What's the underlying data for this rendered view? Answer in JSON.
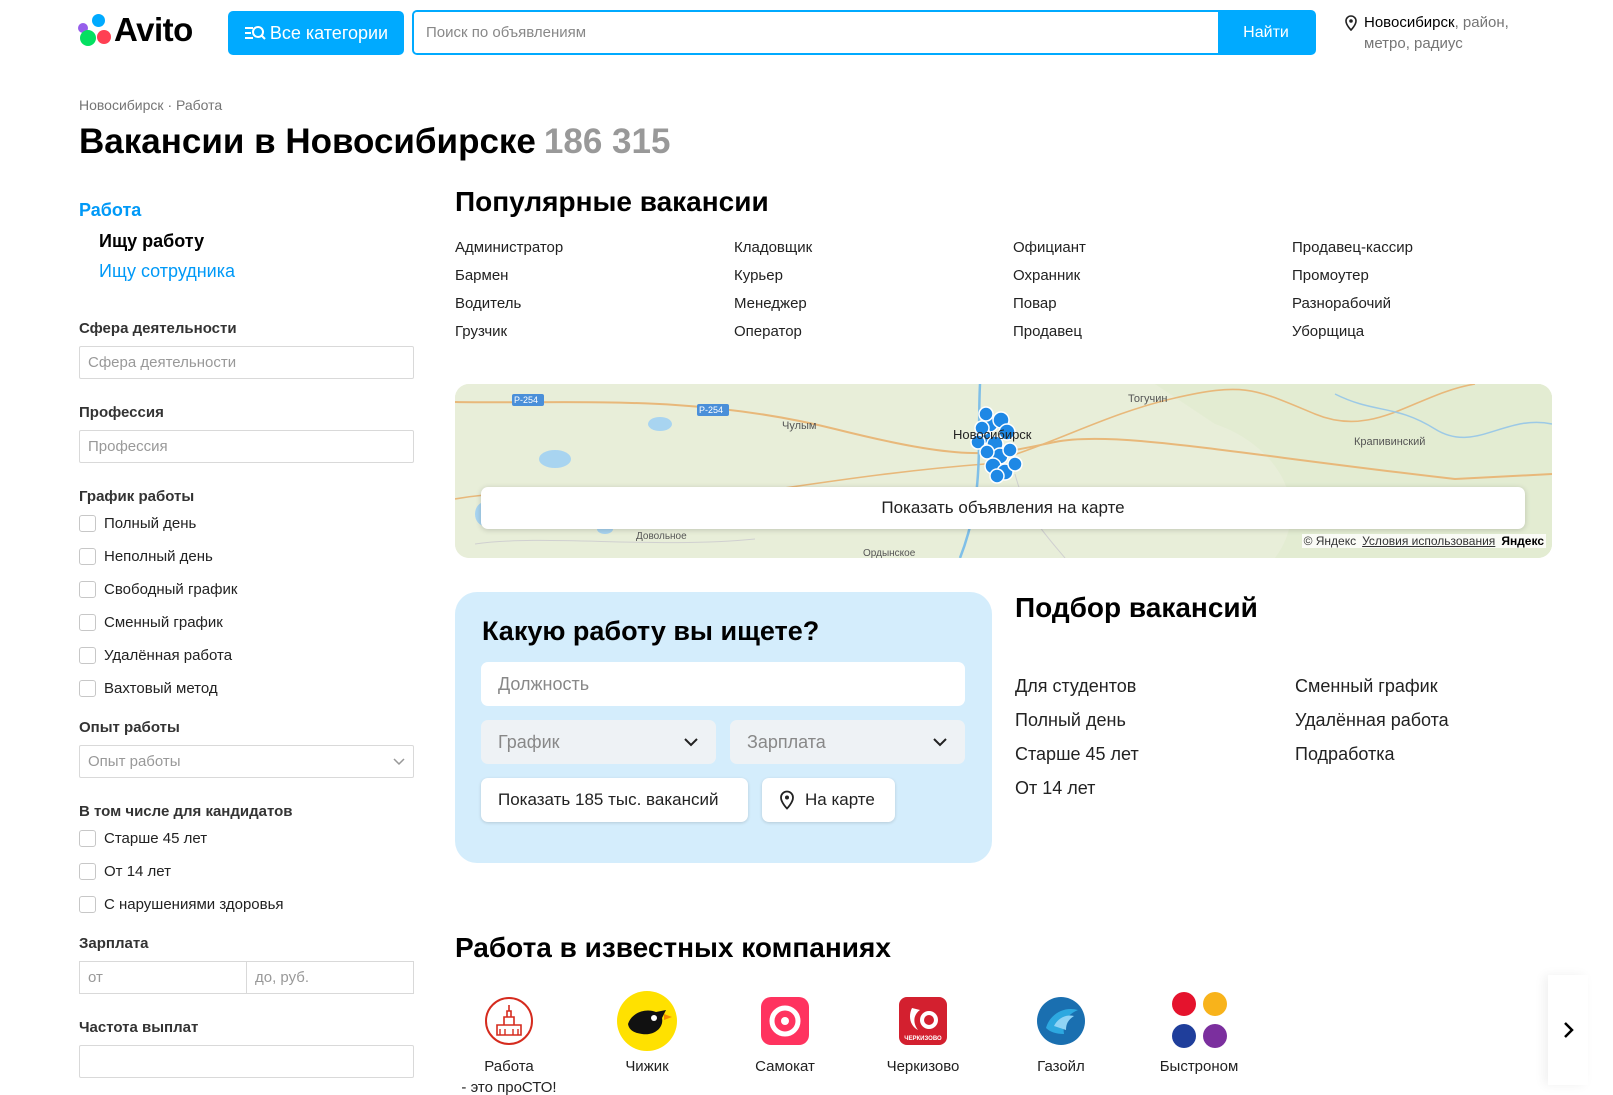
{
  "header": {
    "logo_text": "Avito",
    "categories_label": "Все категории",
    "search_placeholder": "Поиск по объявлениям",
    "search_button": "Найти",
    "location_city": "Новосибирск",
    "location_rest": ", район,",
    "location_line2": "метро, радиус"
  },
  "breadcrumb": {
    "city": "Новосибирск",
    "separator": "·",
    "section": "Работа"
  },
  "title": {
    "text": "Вакансии в Новосибирске",
    "count": "186 315"
  },
  "sidebar": {
    "category": "Работа",
    "sub_active": "Ищу работу",
    "sub_link": "Ищу сотрудника",
    "sphere_label": "Сфера деятельности",
    "sphere_placeholder": "Сфера деятельности",
    "profession_label": "Профессия",
    "profession_placeholder": "Профессия",
    "schedule_label": "График работы",
    "schedule_options": [
      "Полный день",
      "Неполный день",
      "Свободный график",
      "Сменный график",
      "Удалённая работа",
      "Вахтовый метод"
    ],
    "experience_label": "Опыт работы",
    "experience_placeholder": "Опыт работы",
    "candidates_label": "В том числе для кандидатов",
    "candidates_options": [
      "Старше 45 лет",
      "От 14 лет",
      "С нарушениями здоровья"
    ],
    "salary_label": "Зарплата",
    "salary_from": "от",
    "salary_to": "до, руб.",
    "frequency_label": "Частота выплат"
  },
  "popular": {
    "title": "Популярные вакансии",
    "items": [
      "Администратор",
      "Кладовщик",
      "Официант",
      "Продавец-кассир",
      "Бармен",
      "Курьер",
      "Охранник",
      "Промоутер",
      "Водитель",
      "Менеджер",
      "Повар",
      "Разнорабочий",
      "Грузчик",
      "Оператор",
      "Продавец",
      "Уборщица"
    ]
  },
  "map": {
    "button": "Показать объявления на карте",
    "places": [
      "Р-254",
      "Р-254",
      "Чулым",
      "Новосибирск",
      "Тогучин",
      "Крапивинский",
      "Довольное",
      "Ордынское"
    ],
    "copyright": "© Яндекс",
    "terms": "Условия использования",
    "brand": "Яндекс"
  },
  "finder": {
    "title": "Какую работу вы ищете?",
    "position_placeholder": "Должность",
    "schedule_placeholder": "График",
    "salary_placeholder": "Зарплата",
    "show_button": "Показать 185 тыс. вакансий",
    "map_button": "На карте"
  },
  "selections": {
    "title": "Подбор вакансий",
    "items": [
      "Для студентов",
      "Сменный график",
      "Полный день",
      "Удалённая работа",
      "Старше 45 лет",
      "Подработка",
      "От 14 лет"
    ]
  },
  "companies": {
    "title": "Работа в известных компаниях",
    "items": [
      {
        "name_line1": "Работа",
        "name_line2": "- это проСТО!"
      },
      {
        "name_line1": "Чижик",
        "name_line2": ""
      },
      {
        "name_line1": "Самокат",
        "name_line2": ""
      },
      {
        "name_line1": "Черкизово",
        "name_line2": ""
      },
      {
        "name_line1": "Газойл",
        "name_line2": ""
      },
      {
        "name_line1": "Быстроном",
        "name_line2": ""
      }
    ],
    "cherkizovo_logo_text": "ЧЕРКИЗОВО"
  },
  "colors": {
    "accent": "#00aaff",
    "link": "#0099f7",
    "finder_bg": "#d4edfc",
    "map_pin": "#1e88e5"
  },
  "icons": [
    "categories-icon",
    "location-pin-icon",
    "chevron-down-icon",
    "map-pin-icon",
    "chevron-right-icon"
  ]
}
